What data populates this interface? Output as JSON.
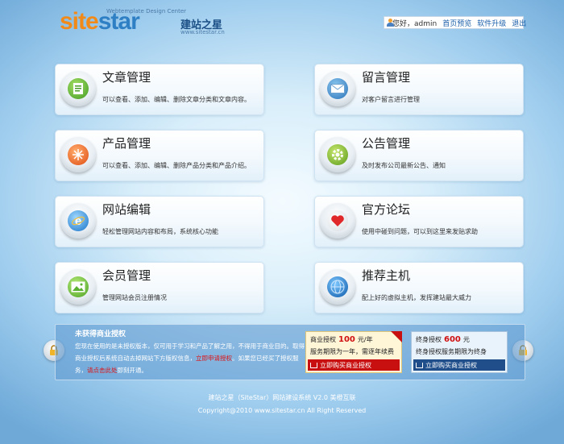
{
  "logo": {
    "main_a": "site",
    "main_b": "star",
    "cn": "建站之星",
    "tagline": "Webtemplate Design Center",
    "url": "www.sitestar.cn"
  },
  "topbar": {
    "greeting": "您好，admin",
    "home": "首页预览",
    "upgrade": "软件升级",
    "logout": "退出"
  },
  "cards": [
    {
      "title": "文章管理",
      "desc": "可以查看、添加、编辑、删除文章分类和文章内容。"
    },
    {
      "title": "留言管理",
      "desc": "对客户留言进行管理"
    },
    {
      "title": "产品管理",
      "desc": "可以查看、添加、编辑、删除产品分类和产品介绍。"
    },
    {
      "title": "公告管理",
      "desc": "及时发布公司最新公告、通知"
    },
    {
      "title": "网站编辑",
      "desc": "轻松管理网站内容和布局，系统核心功能"
    },
    {
      "title": "官方论坛",
      "desc": "使用中碰到问题，可以到这里来发贴求助"
    },
    {
      "title": "会员管理",
      "desc": "管理网站会员注册情况"
    },
    {
      "title": "推荐主机",
      "desc": "配上好的虚拟主机，发挥建站最大威力"
    }
  ],
  "license": {
    "heading": "未获得商业授权",
    "text_1": "您现在使用的是未授权版本，仅可用于学习和产品了解之用，不得用于商业目的。取得商业授权后系统自动去掉网站下方版权信息，",
    "link_apply": "立即申请授权",
    "text_2": "。如果您已经买了授权服务，",
    "link_login": "请点击此处",
    "text_3": "即刻开通。",
    "plan1": {
      "label": "商业授权",
      "price": "100",
      "unit": "元/年",
      "line2": "服务期限为一年，需逐年续费",
      "button": "立即购买商业授权"
    },
    "plan2": {
      "label": "终身授权",
      "price": "600",
      "unit": "元",
      "line2": "终身授权服务期限为终身",
      "button": "立即购买商业授权"
    }
  },
  "footer": {
    "line1": "建站之星（SiteStar）网站建设系统 V2.0 美橙互联",
    "line2": "Copyright@2010 www.sitestar.cn All Right Reserved"
  }
}
